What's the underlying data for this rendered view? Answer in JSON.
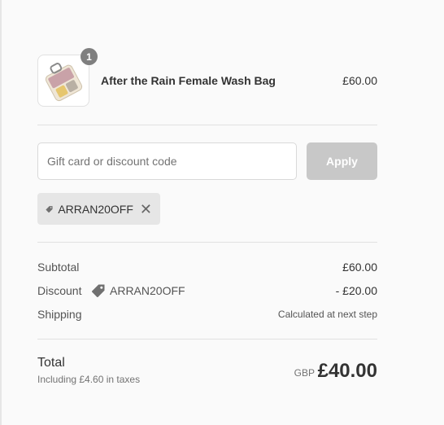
{
  "cart": {
    "items": [
      {
        "name": "After the Rain Female Wash Bag",
        "price": "£60.00",
        "quantity": "1",
        "image_icon": "wash-bag-image"
      }
    ]
  },
  "discount": {
    "placeholder": "Gift card or discount code",
    "apply_label": "Apply",
    "applied_code": "ARRAN20OFF",
    "tag_icon": "tag-icon",
    "remove_icon": "close-icon"
  },
  "summary": {
    "subtotal_label": "Subtotal",
    "subtotal_value": "£60.00",
    "discount_label": "Discount",
    "discount_code": "ARRAN20OFF",
    "discount_value": "- £20.00",
    "shipping_label": "Shipping",
    "shipping_value": "Calculated at next step"
  },
  "total": {
    "label": "Total",
    "tax_note": "Including £4.60 in taxes",
    "currency": "GBP",
    "amount": "£40.00"
  },
  "colors": {
    "apply_disabled_bg": "#c8c8c8",
    "applied_tag_bg": "#e6e6e6",
    "badge_bg": "#7f7f7f"
  }
}
